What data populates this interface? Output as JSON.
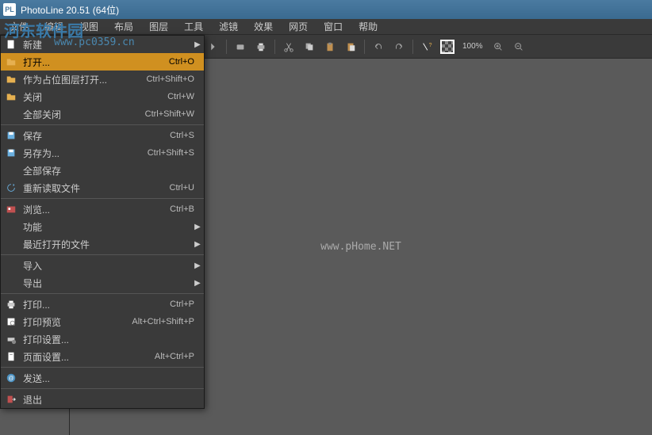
{
  "title": "PhotoLine 20.51 (64位)",
  "menubar": [
    "文件",
    "编辑",
    "视图",
    "布局",
    "图层",
    "工具",
    "滤镜",
    "效果",
    "网页",
    "窗口",
    "帮助"
  ],
  "watermark_top": "河东软件园",
  "watermark_url": "www.pc0359.cn",
  "watermark_center": "www.pHome.NET",
  "zoom": "100%",
  "dropdown": [
    {
      "type": "item",
      "icon": "new",
      "label": "新建",
      "shortcut": "",
      "arrow": true
    },
    {
      "type": "item",
      "icon": "open",
      "label": "打开...",
      "shortcut": "Ctrl+O",
      "highlighted": true
    },
    {
      "type": "item",
      "icon": "open",
      "label": "作为占位图层打开...",
      "shortcut": "Ctrl+Shift+O"
    },
    {
      "type": "item",
      "icon": "open",
      "label": "关闭",
      "shortcut": "Ctrl+W"
    },
    {
      "type": "item",
      "icon": "",
      "label": "全部关闭",
      "shortcut": "Ctrl+Shift+W"
    },
    {
      "type": "sep"
    },
    {
      "type": "item",
      "icon": "save",
      "label": "保存",
      "shortcut": "Ctrl+S"
    },
    {
      "type": "item",
      "icon": "save",
      "label": "另存为...",
      "shortcut": "Ctrl+Shift+S"
    },
    {
      "type": "item",
      "icon": "",
      "label": "全部保存",
      "shortcut": ""
    },
    {
      "type": "item",
      "icon": "reload",
      "label": "重新读取文件",
      "shortcut": "Ctrl+U"
    },
    {
      "type": "sep"
    },
    {
      "type": "item",
      "icon": "browse",
      "label": "浏览...",
      "shortcut": "Ctrl+B"
    },
    {
      "type": "item",
      "icon": "",
      "label": "功能",
      "shortcut": "",
      "arrow": true
    },
    {
      "type": "item",
      "icon": "",
      "label": "最近打开的文件",
      "shortcut": "",
      "arrow": true
    },
    {
      "type": "sep"
    },
    {
      "type": "item",
      "icon": "",
      "label": "导入",
      "shortcut": "",
      "arrow": true
    },
    {
      "type": "item",
      "icon": "",
      "label": "导出",
      "shortcut": "",
      "arrow": true
    },
    {
      "type": "sep"
    },
    {
      "type": "item",
      "icon": "print",
      "label": "打印...",
      "shortcut": "Ctrl+P"
    },
    {
      "type": "item",
      "icon": "preview",
      "label": "打印预览",
      "shortcut": "Alt+Ctrl+Shift+P"
    },
    {
      "type": "item",
      "icon": "setup",
      "label": "打印设置...",
      "shortcut": ""
    },
    {
      "type": "item",
      "icon": "page",
      "label": "页面设置...",
      "shortcut": "Alt+Ctrl+P"
    },
    {
      "type": "sep"
    },
    {
      "type": "item",
      "icon": "mail",
      "label": "发送...",
      "shortcut": ""
    },
    {
      "type": "sep"
    },
    {
      "type": "item",
      "icon": "exit",
      "label": "退出",
      "shortcut": ""
    }
  ],
  "toolbar_icons": [
    "new-doc",
    "text-doc",
    "open-folder",
    "table",
    "align",
    "prev",
    "next",
    "scan",
    "print",
    "cut",
    "copy",
    "paste",
    "clipboard",
    "undo",
    "redo",
    "help",
    "transparency"
  ]
}
